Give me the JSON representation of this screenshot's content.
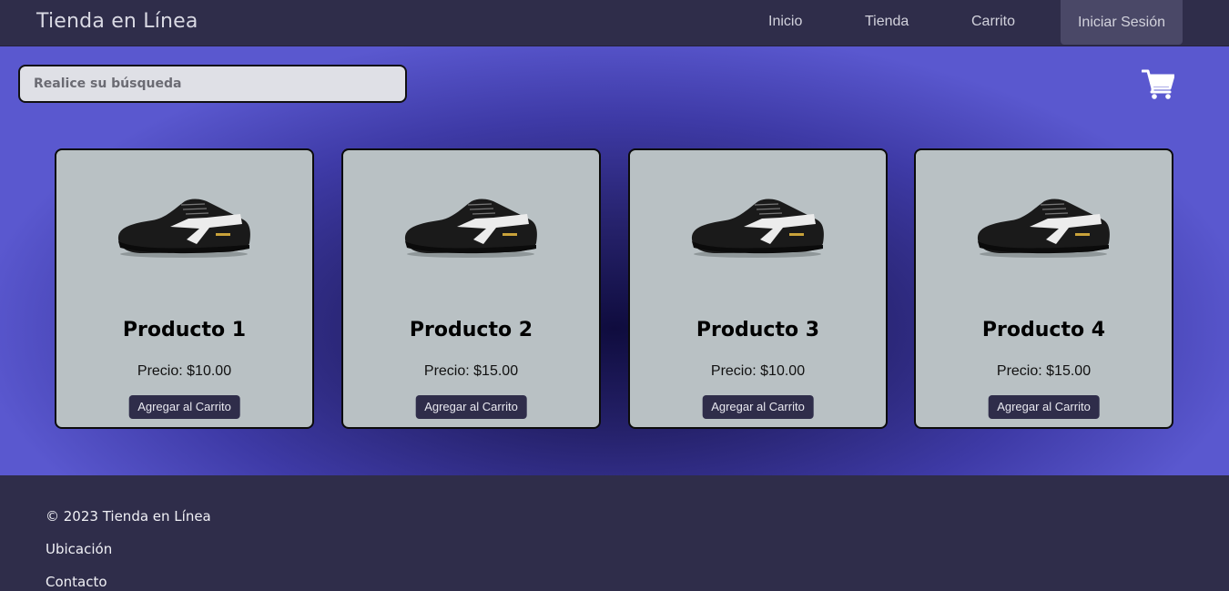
{
  "header": {
    "brand": "Tienda en Línea",
    "nav": [
      "Inicio",
      "Tienda",
      "Carrito"
    ],
    "login_label": "Iniciar Sesión"
  },
  "search": {
    "placeholder": "Realice su búsqueda"
  },
  "cart_icon": "shopping-cart-icon",
  "products": [
    {
      "name": "Producto 1",
      "price": "Precio: $10.00",
      "button": "Agregar al Carrito"
    },
    {
      "name": "Producto 2",
      "price": "Precio: $15.00",
      "button": "Agregar al Carrito"
    },
    {
      "name": "Producto 3",
      "price": "Precio: $10.00",
      "button": "Agregar al Carrito"
    },
    {
      "name": "Producto 4",
      "price": "Precio: $15.00",
      "button": "Agregar al Carrito"
    }
  ],
  "footer": {
    "copyright": "© 2023 Tienda en Línea",
    "location": "Ubicación",
    "contact": "Contacto"
  },
  "colors": {
    "header_bg": "#2f2d4a",
    "card_bg": "#b9c1c4",
    "accent_dark": "#2f2d4a",
    "hero_edge": "#5a58cf",
    "hero_center": "#0f0c3e"
  }
}
